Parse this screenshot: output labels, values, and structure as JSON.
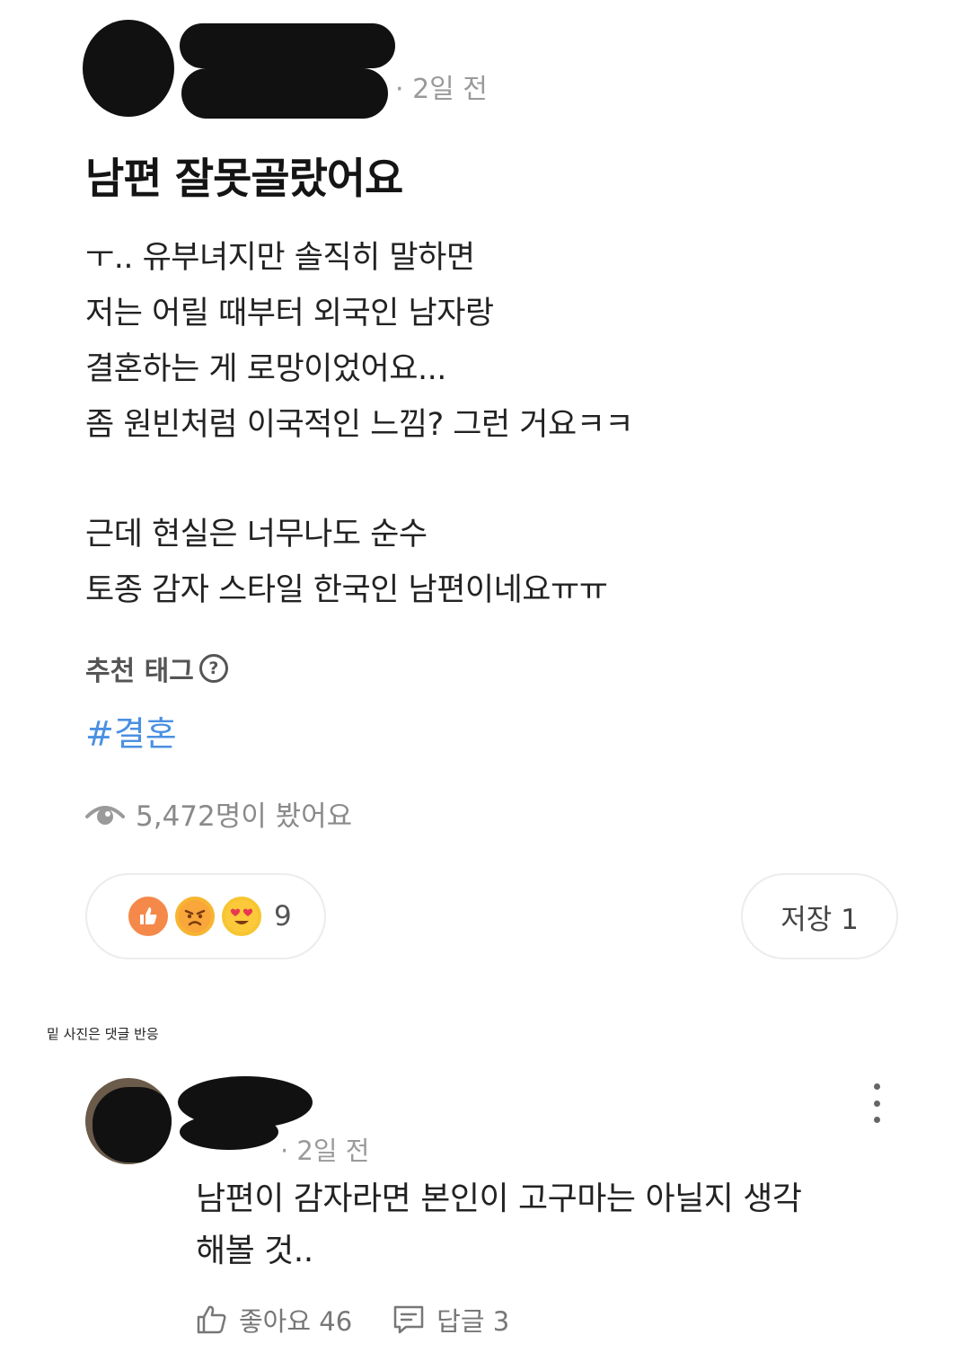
{
  "post": {
    "meta": "· 2일 전",
    "title": "남편 잘못골랐어요",
    "body_lines_1": [
      "ㅜ.. 유부녀지만 솔직히 말하면",
      "저는 어릴 때부터 외국인 남자랑",
      "결혼하는 게 로망이었어요...",
      "좀 원빈처럼 이국적인 느낌? 그런 거요ㅋㅋ"
    ],
    "body_lines_2": [
      "근데 현실은 너무나도 순수",
      "토종 감자 스타일 한국인 남편이네요ㅠㅠ"
    ],
    "tag_heading": "추천 태그",
    "tag": "#결혼",
    "views": "5,472명이 봤어요",
    "reaction_count": "9",
    "save_label": "저장 1"
  },
  "caption_note": "밑 사진은 댓글 반응",
  "comment": {
    "meta": "· 2일 전",
    "text_lines": [
      "남편이 감자라면 본인이 고구마는 아닐지 생각",
      "해볼 것.."
    ],
    "like_label": "좋아요 46",
    "reply_label": "답글 3"
  },
  "icons": {
    "views": "eye-icon",
    "help": "question-circle-icon",
    "more": "more-vertical-icon",
    "like": "thumbs-up-icon",
    "reply": "comment-icon"
  },
  "colors": {
    "tag": "#4a90e2",
    "meta": "#9a9a9a",
    "like_reaction": "#f4894a",
    "emoji_yellow": "#f7b531"
  }
}
